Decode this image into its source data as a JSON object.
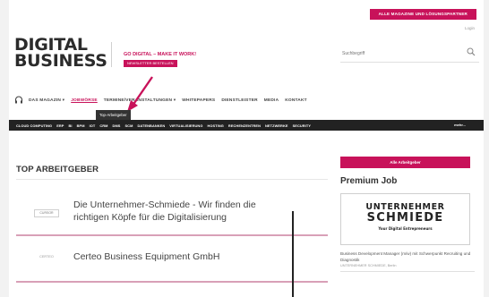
{
  "header": {
    "cta_label": "ALLE MAGAZINE UND LÖSUNGSPARTNER",
    "login_label": "Login",
    "logo_line1": "DIGITAL",
    "logo_line2": "BUSINESS",
    "tagline": "GO DIGITAL – MAKE IT WORK!",
    "tagline_badge": "NEWSLETTER BESTELLEN",
    "search_placeholder": "Suchbegriff"
  },
  "nav": {
    "items": [
      {
        "label": "DAS MAGAZIN ▾",
        "active": false
      },
      {
        "label": "JOBWÖRSE",
        "active": true
      },
      {
        "label": "TERMINE/VERANSTALTUNGEN ▾",
        "active": false
      },
      {
        "label": "WHITEPAPERS",
        "active": false
      },
      {
        "label": "DIENSTLEISTER",
        "active": false
      },
      {
        "label": "MEDIA",
        "active": false
      },
      {
        "label": "KONTAKT",
        "active": false
      }
    ],
    "tooltip": "Top-Arbeitgeber"
  },
  "subnav": {
    "items": [
      "CLOUD COMPUTING",
      "ERP",
      "BI",
      "BPM",
      "IOT",
      "CRM",
      "DMS",
      "SCM",
      "DATENBANKEN",
      "VIRTUALISIERUNG",
      "HOSTING",
      "RECHENZENTREN",
      "NETZWERKE",
      "SECURITY"
    ],
    "more": "mehr..."
  },
  "main": {
    "section_title": "TOP ARBEITGEBER",
    "rows": [
      {
        "logo_text": "CURSOR",
        "title": "Die Unternehmer-Schmiede - Wir finden die richtigen Köpfe für die Digitalisierung"
      },
      {
        "logo_text": "CERTEO",
        "title": "Certeo Business Equipment GmbH"
      }
    ]
  },
  "aside": {
    "button_label": "Alle Arbeitgeber",
    "title": "Premium Job",
    "card_line1": "UNTERNEHMER",
    "card_line2": "SCHMIEDE",
    "card_line3": "Your Digital Entrepreneurs",
    "desc": "Business Development Manager (m/w) mit Schwerpunkt Recruiting und Diagnostik",
    "meta": "UNTERNEHMER SCHMIEDE, Berlin"
  },
  "colors": {
    "accent": "#c8125a",
    "subnav_bg": "#222222"
  }
}
